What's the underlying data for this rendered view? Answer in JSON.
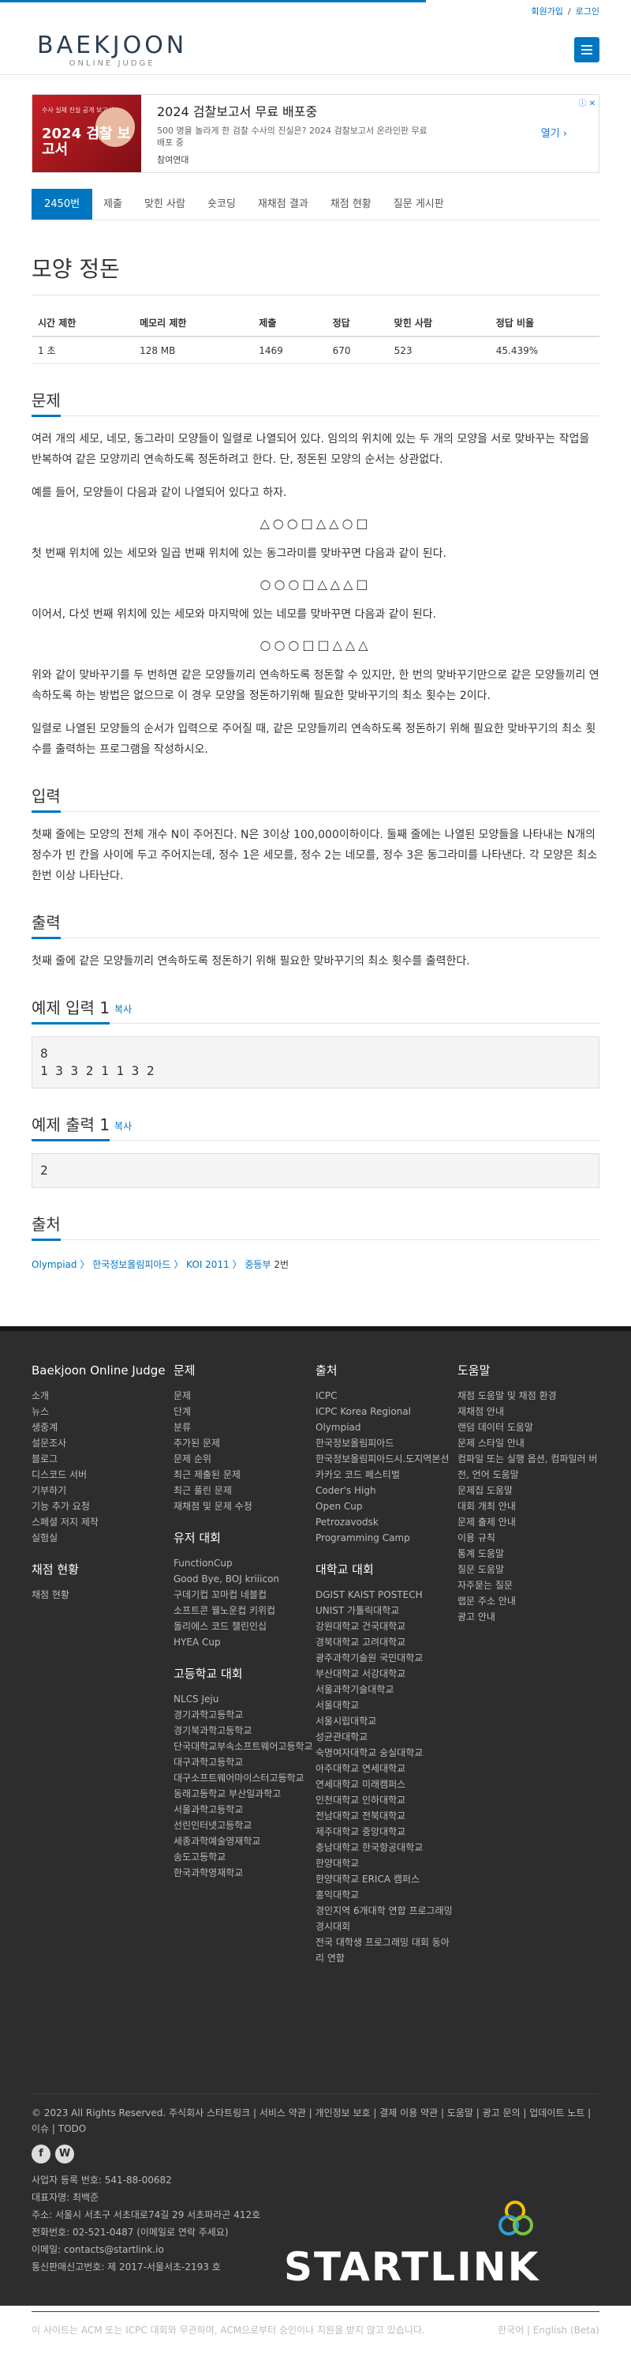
{
  "topbar": {
    "signup": "회원가입",
    "login": "로그인"
  },
  "logo": {
    "main": "BAEKJOON",
    "sub": "ONLINE JUDGE"
  },
  "ad": {
    "image_caption_small": "수사 실체 진실 공개 보고서",
    "image_caption_big": "2024 검찰 보고서",
    "title": "2024 검찰보고서 무료 배포중",
    "desc": "500 명을 놀라게 한 검찰 수사의 진실은? 2024 검찰보고서 온라인판 무료 배포 중",
    "source": "참여연대",
    "open": "열기 ›",
    "close": "ⓘ ✕"
  },
  "tabs": [
    "2450번",
    "제출",
    "맞힌 사람",
    "숏코딩",
    "재채점 결과",
    "채점 현황",
    "질문 게시판"
  ],
  "problem": {
    "title": "모양 정돈",
    "headers": [
      "시간 제한",
      "메모리 제한",
      "제출",
      "정답",
      "맞힌 사람",
      "정답 비율"
    ],
    "values": [
      "1 초",
      "128 MB",
      "1469",
      "670",
      "523",
      "45.439%"
    ]
  },
  "sections": {
    "desc_title": "문제",
    "p1": "여러 개의 세모, 네모, 동그라미 모양들이 일렬로 나열되어 있다. 임의의 위치에 있는 두 개의 모양을 서로 맞바꾸는 작업을 반복하여 같은 모양끼리 연속하도록 정돈하려고 한다. 단, 정돈된 모양의 순서는 상관없다.",
    "p2": "예를 들어, 모양들이 다음과 같이 나열되어 있다고 하자.",
    "seq1": "△○○□△△○□",
    "p3": "첫 번째 위치에 있는 세모와 일곱 번째 위치에 있는 동그라미를 맞바꾸면 다음과 같이 된다.",
    "seq2": "○○○□△△△□",
    "p4": "이어서, 다섯 번째 위치에 있는 세모와 마지막에 있는 네모를 맞바꾸면 다음과 같이 된다.",
    "seq3": "○○○□□△△△",
    "p5": "위와 같이 맞바꾸기를 두 번하면 같은 모양들끼리 연속하도록 정돈할 수 있지만, 한 번의 맞바꾸기만으로 같은 모양들끼리 연속하도록 하는 방법은 없으므로 이 경우 모양을 정돈하기위해 필요한 맞바꾸기의 최소 횟수는 2이다.",
    "p6": "일렬로 나열된 모양들의 순서가 입력으로 주어질 때, 같은 모양들끼리 연속하도록 정돈하기 위해 필요한 맞바꾸기의 최소 횟수를 출력하는 프로그램을 작성하시오.",
    "input_title": "입력",
    "input_text": "첫째 줄에는 모양의 전체 개수 N이 주어진다. N은 3이상 100,000이하이다. 둘째 줄에는 나열된 모양들을 나타내는 N개의 정수가 빈 칸을 사이에 두고 주어지는데, 정수 1은 세모를, 정수 2는 네모를, 정수 3은 동그라미를 나타낸다. 각 모양은 최소 한번 이상 나타난다.",
    "output_title": "출력",
    "output_text": "첫째 줄에 같은 모양들끼리 연속하도록 정돈하기 위해 필요한 맞바꾸기의 최소 횟수를 출력한다.",
    "sample_in_title": "예제 입력 1",
    "sample_out_title": "예제 출력 1",
    "copy": "복사",
    "sample_in": "8\n1 3 3 2 1 1 3 2",
    "sample_out": "2",
    "source_title": "출처"
  },
  "breadcrumb": {
    "a": "Olympiad",
    "b": "한국정보올림피아드",
    "c": "KOI 2011",
    "d": "중등부",
    "e": "2번"
  },
  "footer": {
    "col1": {
      "title": "Baekjoon Online Judge",
      "items": [
        "소개",
        "뉴스",
        "생중계",
        "설문조사",
        "블로그",
        "디스코드 서버",
        "기부하기",
        "기능 추가 요청",
        "스페셜 저지 제작",
        "실험실"
      ],
      "title2": "채점 현황",
      "items2": [
        "채점 현황"
      ]
    },
    "col2": {
      "title": "문제",
      "items": [
        "문제",
        "단계",
        "분류",
        "추가된 문제",
        "문제 순위",
        "최근 제출된 문제",
        "최근 풀린 문제",
        "재채점 및 문제 수정"
      ],
      "title2": "유저 대회",
      "items2": [
        "FunctionCup",
        "Good Bye, BOJ kriiicon",
        "구데기컵 꼬마컵 네블컵",
        "소프트콘 웰노운컵 키위컵",
        "돌리에스 코드 챌린인십",
        "HYEA Cup"
      ],
      "title3": "고등학교 대회",
      "items3": [
        "NLCS Jeju",
        "경기과학고등학교",
        "경기북과학고등학교",
        "단국대학교부속소프트웨어고등학교",
        "대구과학고등학교",
        "대구소프트웨어마이스터고등학교",
        "동래고등학교 부산일과학고",
        "서울과학고등학교",
        "선린인터넷고등학교",
        "세종과학예술영재학교",
        "송도고등학교",
        "한국과학영재학교"
      ]
    },
    "col3": {
      "title": "출처",
      "items": [
        "ICPC",
        "ICPC Korea Regional",
        "Olympiad",
        "한국정보올림피아드",
        "한국정보올림피아드시.도지역본선",
        "카카오 코드 페스티벌",
        "Coder's High",
        "Open Cup",
        "Petrozavodsk",
        "Programming Camp"
      ],
      "title2": "대학교 대회",
      "items2": [
        "DGIST KAIST POSTECH",
        "UNIST 가톨릭대학교",
        "강원대학교 건국대학교",
        "경북대학교 고려대학교",
        "광주과학기술원 국민대학교",
        "부산대학교 서강대학교",
        "서울과학기술대학교",
        "서울대학교",
        "서울시립대학교",
        "성균관대학교",
        "숙명여자대학교 숭실대학교",
        "아주대학교 연세대학교",
        "연세대학교 미래캠퍼스",
        "인천대학교 인하대학교",
        "전남대학교 전북대학교",
        "제주대학교 중앙대학교",
        "충남대학교 한국항공대학교",
        "한양대학교",
        "한양대학교 ERICA 캠퍼스",
        "홍익대학교",
        "경인지역 6개대학 연합 프로그래밍 경시대회",
        "전국 대학생 프로그래밍 대회 동아리 연합"
      ]
    },
    "col4": {
      "title": "도움말",
      "items": [
        "채점 도움말 및 채점 환경",
        "재채점 안내",
        "랜덤 데이터 도움말",
        "문제 스타일 안내",
        "컴파일 또는 실행 옵션, 컴파일러 버전, 언어 도움말",
        "문제집 도움말",
        "대회 개최 안내",
        "문제 출제 안내",
        "이용 규칙",
        "통계 도움말",
        "질문 도움말",
        "자주묻는 질문",
        "랩문 주소 안내",
        "광고 안내"
      ]
    },
    "links": "© 2023 All Rights Reserved. 주식회사 스타트링크 | 서비스 약관 | 개인정보 보호 | 결제 이용 약관 | 도움말 | 광고 문의 | 업데이트 노트 | 이슈 | TODO",
    "social": [
      "f",
      "W"
    ],
    "company": [
      "사업자 등록 번호: 541-88-00682",
      "대표자명: 최백준",
      "주소: 서울시 서초구 서초대로74길 29 서초파라곤 412호",
      "전화번호: 02-521-0487 (이메일로 연락 주세요)",
      "이메일: contacts@startlink.io",
      "통신판매신고번호: 제 2017-서울서초-2193 호"
    ],
    "brand": "STARTLINK",
    "note": "이 사이트는 ACM 또는 ICPC 대회와 무관하며, ACM으로부터 승인이나 지원을 받지 않고 있습니다.",
    "lang": "한국어 | English (Beta)"
  }
}
